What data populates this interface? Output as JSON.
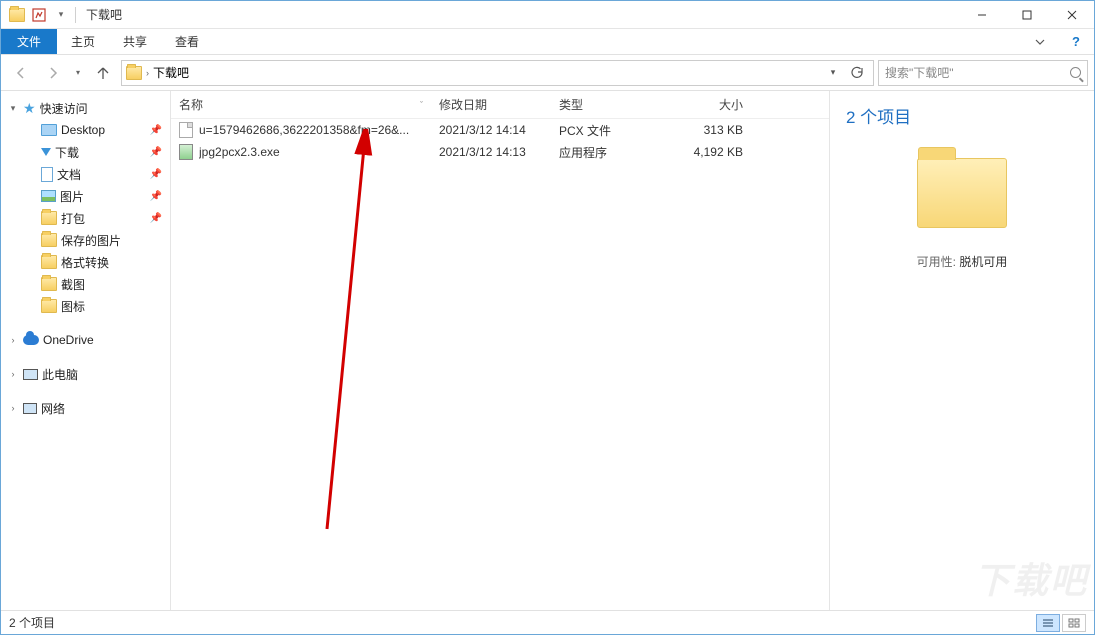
{
  "window": {
    "title": "下载吧",
    "controls": {
      "min": "—",
      "max": "☐",
      "close": "✕"
    }
  },
  "ribbon": {
    "file": "文件",
    "tabs": [
      "主页",
      "共享",
      "查看"
    ]
  },
  "nav": {
    "back": "←",
    "forward": "→",
    "up": "↑",
    "breadcrumb": [
      "下载吧"
    ],
    "refresh": "⟳",
    "search_placeholder": "搜索\"下载吧\""
  },
  "tree": {
    "quick_access": {
      "label": "快速访问",
      "expanded": true
    },
    "qa_items": [
      {
        "label": "Desktop",
        "icon": "desktop",
        "pinned": true
      },
      {
        "label": "下载",
        "icon": "download",
        "pinned": true
      },
      {
        "label": "文档",
        "icon": "doc",
        "pinned": true
      },
      {
        "label": "图片",
        "icon": "pic",
        "pinned": true
      },
      {
        "label": "打包",
        "icon": "folder",
        "pinned": true
      },
      {
        "label": "保存的图片",
        "icon": "folder",
        "pinned": false
      },
      {
        "label": "格式转换",
        "icon": "folder",
        "pinned": false
      },
      {
        "label": "截图",
        "icon": "folder",
        "pinned": false
      },
      {
        "label": "图标",
        "icon": "folder",
        "pinned": false
      }
    ],
    "onedrive": "OneDrive",
    "thispc": "此电脑",
    "network": "网络"
  },
  "columns": {
    "name": "名称",
    "date": "修改日期",
    "type": "类型",
    "size": "大小"
  },
  "files": [
    {
      "icon": "file",
      "name": "u=1579462686,3622201358&fm=26&...",
      "date": "2021/3/12 14:14",
      "type": "PCX 文件",
      "size": "313 KB"
    },
    {
      "icon": "exe",
      "name": "jpg2pcx2.3.exe",
      "date": "2021/3/12 14:13",
      "type": "应用程序",
      "size": "4,192 KB"
    }
  ],
  "details": {
    "title": "2 个项目",
    "prop_key": "可用性:",
    "prop_val": "脱机可用"
  },
  "statusbar": {
    "text": "2 个项目"
  },
  "watermark": "下载吧"
}
